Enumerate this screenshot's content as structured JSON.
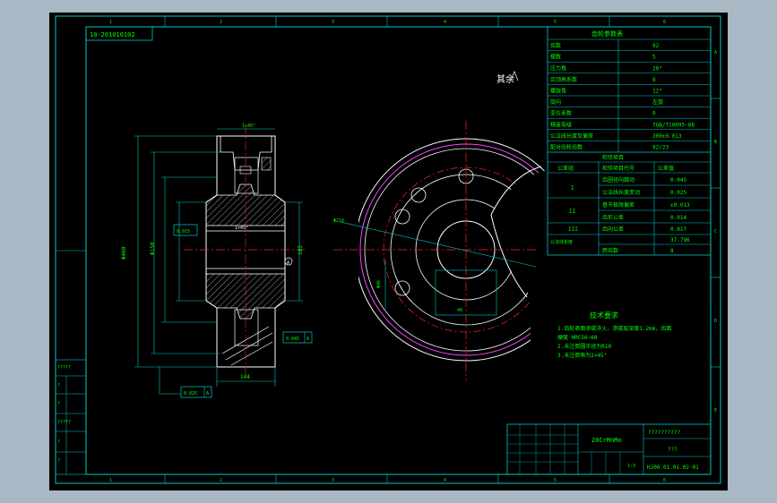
{
  "colors": {
    "background": "#a8b8c4",
    "canvas": "#000000",
    "frame": "#00c8c8",
    "text": "#00ff00",
    "white": "#ffffff",
    "center_line": "#ff2020",
    "magenta": "#ff40ff",
    "cyan_line": "#00c8ff"
  },
  "drawing_number_top": "10-201010102",
  "roughness_note": "其余",
  "param_table": {
    "header": "齿轮参数表",
    "rows": [
      {
        "label": "齿数",
        "value": "92"
      },
      {
        "label": "模数",
        "value": "5"
      },
      {
        "label": "压力角",
        "value": "20°"
      },
      {
        "label": "齿顶高系数",
        "value": "8"
      },
      {
        "label": "螺旋角",
        "value": "12°"
      },
      {
        "label": "旋向",
        "value": "左旋"
      },
      {
        "label": "变位系数",
        "value": "0"
      },
      {
        "label": "精度等级",
        "value": "7GB/T10095-88"
      },
      {
        "label": "公法线长度及偏差",
        "value": "300±0.013"
      },
      {
        "label": "配对齿轮齿数",
        "value": "92/23"
      }
    ],
    "check_header": "检验项目",
    "check_cols": [
      "公差组",
      "检验项目代号",
      "公差值"
    ],
    "check_rows": [
      {
        "group": "I",
        "items": [
          "齿圈径向跳动",
          "公法线长度变动"
        ],
        "values": [
          "0.045",
          "0.025"
        ]
      },
      {
        "group": "II",
        "items": [
          "基节极限偏差",
          "齿形公差"
        ],
        "values": [
          "±0.013",
          "0.014"
        ]
      },
      {
        "group": "III",
        "items": [
          "齿向公差"
        ],
        "values": [
          "0.017"
        ]
      },
      {
        "group": "公法线长度",
        "items": [
          "跨齿数"
        ],
        "values": [
          "37.796",
          "8"
        ]
      }
    ]
  },
  "tech_req": {
    "title": "技术要求",
    "lines": [
      "1.齿轮表面渗碳淬火，渗碳层深度1.2mm，齿面",
      "硬度 HRC56~60",
      "2.未注倒圆半径为R10",
      "3.未注倒角为2×45°"
    ]
  },
  "title_block": {
    "material": "20CrMnMo",
    "company": "??????????",
    "part_name": "???",
    "drawing_no": "HJ00.01.01.02-01",
    "scale": "1:3",
    "left_labels": [
      "?????",
      "?",
      "?",
      "?????",
      "?",
      "?"
    ]
  },
  "dims": {
    "left_chamfer": "1×45°",
    "hub_label": "1×45°",
    "big_dia": "Φ460",
    "bore_dia": "Φ150",
    "ref_width": "144",
    "tol_a": "0.015",
    "tol_b": "0.025",
    "tol_c": "0.045",
    "datum": "A",
    "right_width": "185",
    "right_dia": "Φ216",
    "hole_dia": "Φ46",
    "keyway": "40"
  },
  "border_numbers": {
    "top": [
      "1",
      "2",
      "3",
      "4",
      "5",
      "6"
    ],
    "side": [
      "A",
      "B",
      "C",
      "D",
      "E"
    ]
  }
}
